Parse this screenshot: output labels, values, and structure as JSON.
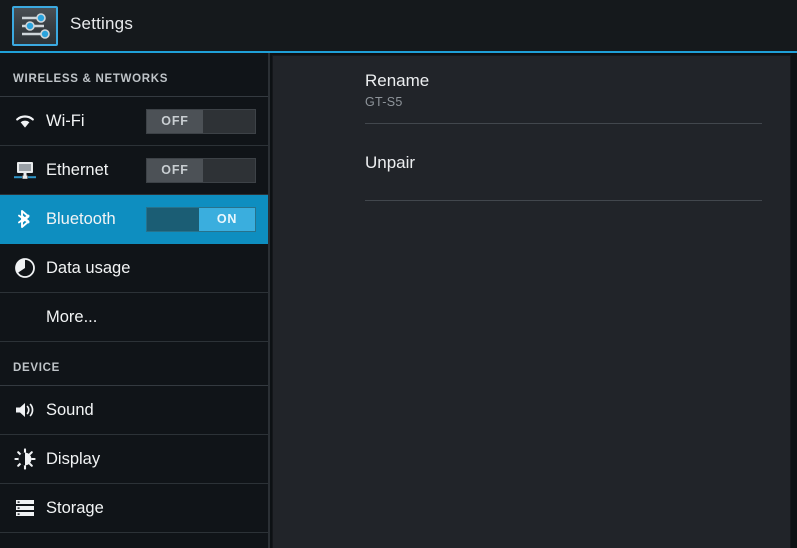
{
  "action_bar": {
    "title": "Settings",
    "icon": "settings-sliders-icon"
  },
  "sidebar": {
    "sections": [
      {
        "header": "WIRELESS & NETWORKS",
        "items": [
          {
            "label": "Wi-Fi",
            "icon": "wifi-icon",
            "toggle": {
              "state": "off",
              "label": "OFF"
            },
            "selected": false
          },
          {
            "label": "Ethernet",
            "icon": "ethernet-icon",
            "toggle": {
              "state": "off",
              "label": "OFF"
            },
            "selected": false
          },
          {
            "label": "Bluetooth",
            "icon": "bluetooth-icon",
            "toggle": {
              "state": "on",
              "label": "ON"
            },
            "selected": true
          },
          {
            "label": "Data usage",
            "icon": "data-usage-pie-icon",
            "toggle": null,
            "selected": false
          },
          {
            "label": "More...",
            "icon": null,
            "toggle": null,
            "selected": false
          }
        ]
      },
      {
        "header": "DEVICE",
        "items": [
          {
            "label": "Sound",
            "icon": "sound-speaker-icon",
            "toggle": null,
            "selected": false
          },
          {
            "label": "Display",
            "icon": "display-brightness-icon",
            "toggle": null,
            "selected": false
          },
          {
            "label": "Storage",
            "icon": "storage-stack-icon",
            "toggle": null,
            "selected": false
          }
        ]
      }
    ]
  },
  "content": {
    "items": [
      {
        "title": "Rename",
        "summary": "GT-S5"
      },
      {
        "title": "Unpair",
        "summary": ""
      }
    ]
  },
  "colors": {
    "accent": "#1fa0d8",
    "selected_row": "#0e8ec0",
    "toggle_on_thumb": "#3aaede",
    "sidebar_bg": "#101418",
    "content_bg": "#212429"
  }
}
